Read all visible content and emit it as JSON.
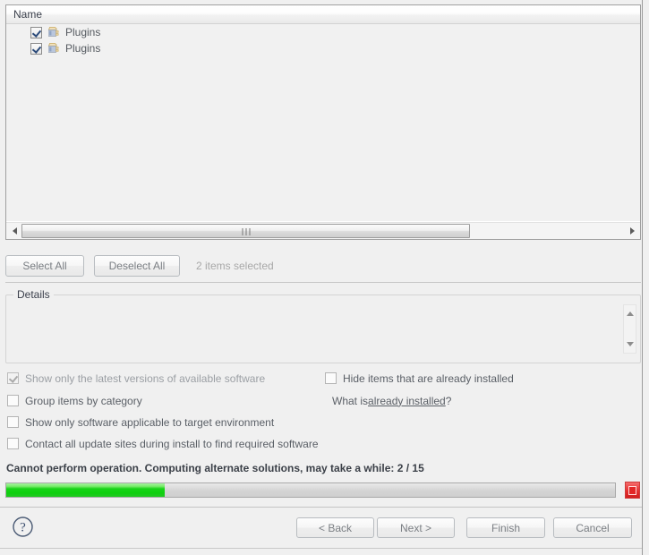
{
  "tree": {
    "column_header": "Name",
    "rows": [
      {
        "label": "Plugins",
        "checked": true,
        "icon": "plugin-icon"
      },
      {
        "label": "Plugins",
        "checked": true,
        "icon": "plugin-icon"
      }
    ],
    "h_scrollbar": {
      "left_arrow_icon": "chevron-left-icon",
      "right_arrow_icon": "chevron-right-icon",
      "thumb_grip_icon": "grip-dots-icon"
    }
  },
  "selection_bar": {
    "select_all_label": "Select All",
    "deselect_all_label": "Deselect All",
    "status_label": "2 items selected"
  },
  "details": {
    "legend": "Details",
    "body_text": "",
    "scroll_up_icon": "triangle-up-icon",
    "scroll_down_icon": "triangle-down-icon"
  },
  "options": {
    "left": [
      {
        "label": "Show only the latest versions of available software",
        "checked": true,
        "disabled": true
      },
      {
        "label": "Group items by category",
        "checked": false,
        "disabled": false
      },
      {
        "label": "Show only software applicable to target environment",
        "checked": false,
        "disabled": false
      },
      {
        "label": "Contact all update sites during install to find required software",
        "checked": false,
        "disabled": false
      }
    ],
    "right": [
      {
        "label": "Hide items that are already installed",
        "checked": false,
        "disabled": false
      }
    ],
    "what_is_prefix": "What is ",
    "what_is_link": "already installed",
    "what_is_suffix": "?"
  },
  "status": {
    "message": "Cannot perform operation. Computing alternate solutions, may take a while: 2 / 15",
    "progress_percent": 26,
    "progress_fill_color": "#12d012",
    "stop_button_label": "",
    "stop_icon": "stop-square-icon"
  },
  "footer": {
    "help_icon": "question-mark-icon",
    "buttons": [
      {
        "label": "< Back",
        "name": "back-button",
        "enabled": false
      },
      {
        "label": "Next >",
        "name": "next-button",
        "enabled": false
      },
      {
        "label": "Finish",
        "name": "finish-button",
        "enabled": false
      },
      {
        "label": "Cancel",
        "name": "cancel-button",
        "enabled": true
      }
    ]
  },
  "colors": {
    "dialog_bg": "#f0f0f0",
    "tree_bg": "#f1f1f1",
    "progress_green": "#12d012",
    "stop_red": "#e22626",
    "text": "#5a5f66"
  }
}
